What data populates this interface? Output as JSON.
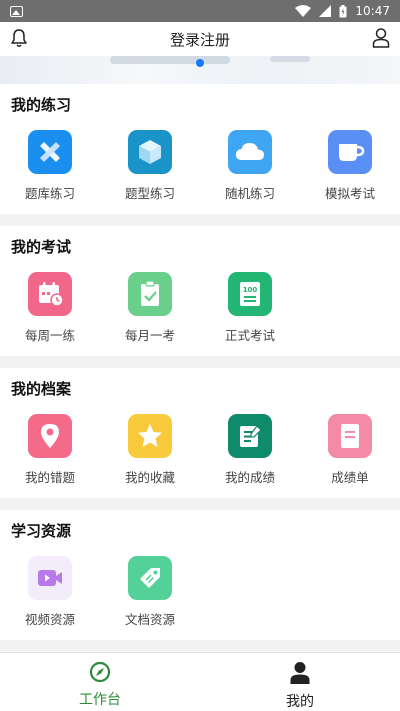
{
  "status_bar": {
    "time": "10:47"
  },
  "header": {
    "title": "登录注册"
  },
  "sections": [
    {
      "title": "我的练习",
      "items": [
        {
          "label": "题库练习",
          "icon": "cross-icon",
          "color": "#1a8ff0"
        },
        {
          "label": "题型练习",
          "icon": "cube-icon",
          "color": "#1a93c9"
        },
        {
          "label": "随机练习",
          "icon": "cloud-icon",
          "color": "#3ea6f2"
        },
        {
          "label": "模拟考试",
          "icon": "cup-icon",
          "color": "#5a8ff5"
        }
      ]
    },
    {
      "title": "我的考试",
      "items": [
        {
          "label": "每周一练",
          "icon": "calendar-clock-icon",
          "color": "#f2668a"
        },
        {
          "label": "每月一考",
          "icon": "clipboard-check-icon",
          "color": "#6bcf8c"
        },
        {
          "label": "正式考试",
          "icon": "score-100-icon",
          "color": "#22b573"
        }
      ]
    },
    {
      "title": "我的档案",
      "items": [
        {
          "label": "我的错题",
          "icon": "location-pin-icon",
          "color": "#f46b8a"
        },
        {
          "label": "我的收藏",
          "icon": "star-icon",
          "color": "#f8c93a"
        },
        {
          "label": "我的成绩",
          "icon": "notepad-edit-icon",
          "color": "#0f8a6a"
        },
        {
          "label": "成绩单",
          "icon": "document-icon",
          "color": "#f58aa6"
        }
      ]
    },
    {
      "title": "学习资源",
      "items": [
        {
          "label": "视频资源",
          "icon": "video-camera-icon",
          "color": "#b87ae8"
        },
        {
          "label": "文档资源",
          "icon": "tag-icon",
          "color": "#54d199"
        }
      ]
    }
  ],
  "tabs": [
    {
      "label": "工作台",
      "icon": "compass-icon",
      "active": true
    },
    {
      "label": "我的",
      "icon": "person-icon",
      "active": false
    }
  ],
  "colors": {
    "accent": "#2e8b3c",
    "indicator": "#1677ff",
    "status_bar": "#6e6e6e"
  }
}
